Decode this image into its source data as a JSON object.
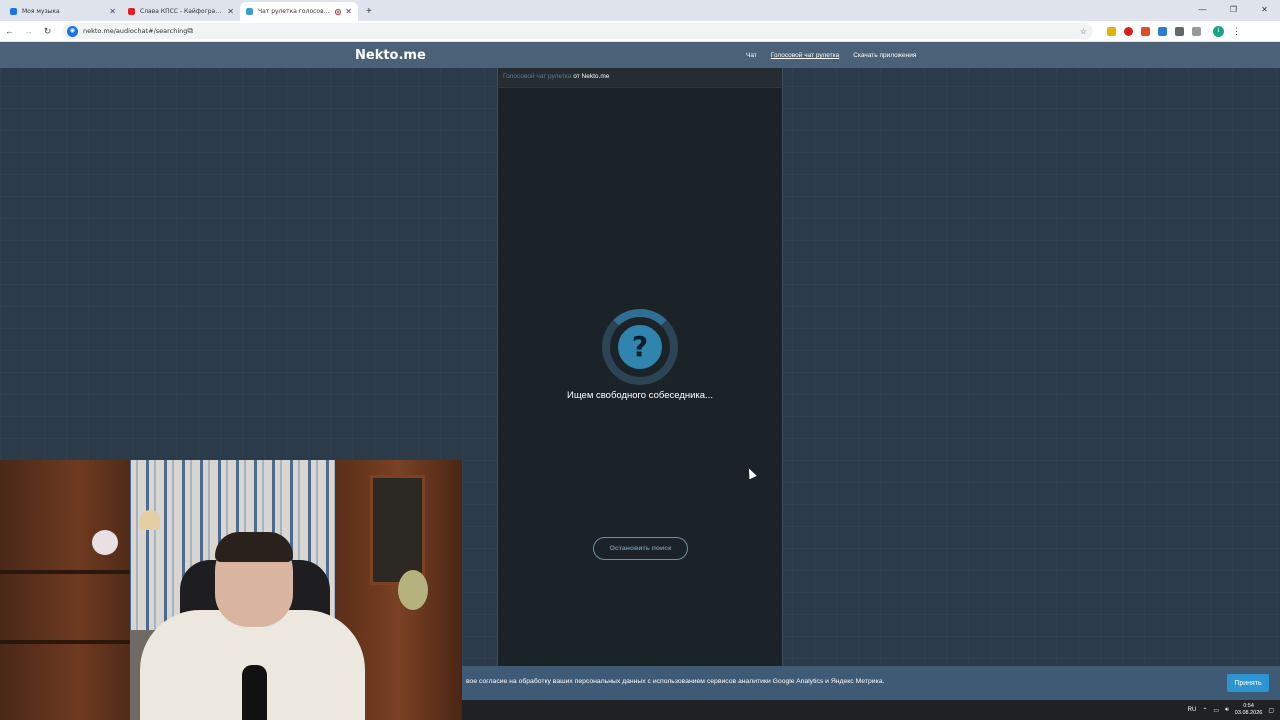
{
  "browser": {
    "tabs": [
      {
        "title": "Моя музыка",
        "favicon_color": "#1a73e8"
      },
      {
        "title": "Слава КПСС - Кайфоград (Sun...",
        "favicon_color": "#e02020"
      },
      {
        "title": "Чат рулетка голосовая — ...",
        "favicon_color": "#3a9bd8",
        "active": true
      }
    ],
    "url": "nekto.me/audiochat#/searching"
  },
  "site": {
    "logo": "Nekto.me",
    "nav": [
      "Чат",
      "Голосовой чат рулетка",
      "Скачать приложения"
    ],
    "panel_link": "Голосовой чат рулетка",
    "panel_suffix": " от Nekto.me",
    "spinner_symbol": "?",
    "status": "Ищем свободного собеседника...",
    "stop_button": "Остановить поиск"
  },
  "cookie": {
    "text": "вое согласие на обработку ваших персональных данных с использованием сервисов аналитики Google Analytics и Яндекс Метрика.",
    "accept": "Принять"
  },
  "taskbar": {
    "lang": "RU",
    "time": "0:54",
    "date": "03.08.2026"
  },
  "colors": {
    "header": "#4a6178",
    "panel": "#1c2328",
    "accent": "#2f85ad",
    "accept_button": "#2e95d3"
  }
}
